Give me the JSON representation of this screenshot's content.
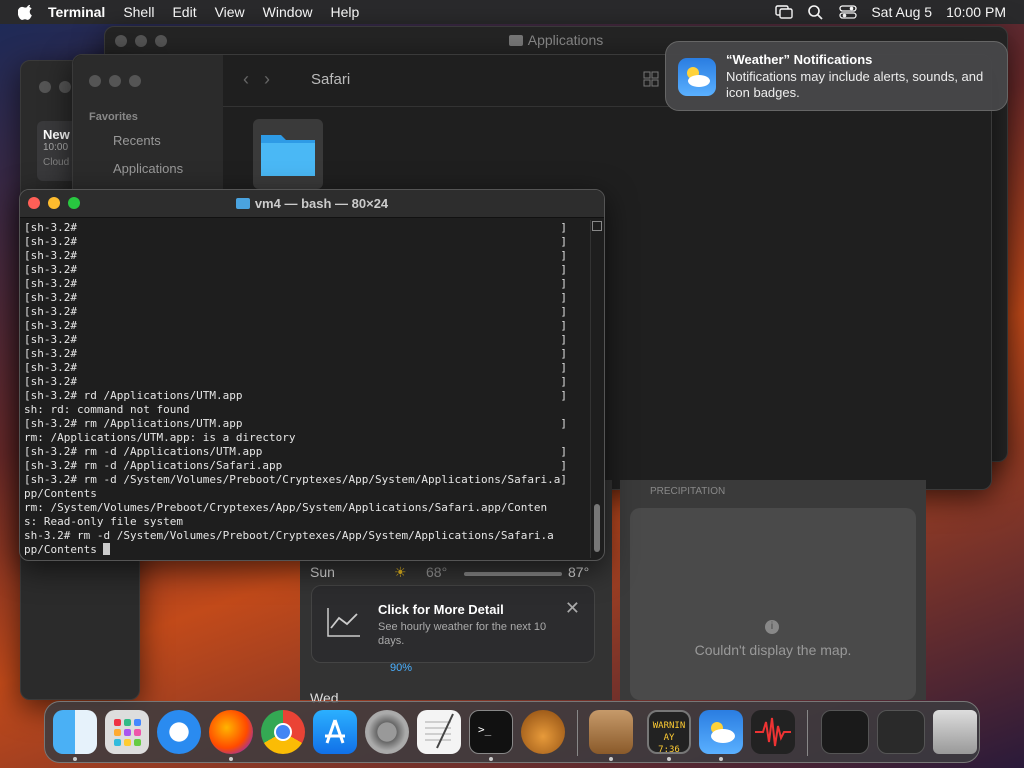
{
  "menubar": {
    "app": "Terminal",
    "items": [
      "Shell",
      "Edit",
      "View",
      "Window",
      "Help"
    ],
    "date": "Sat Aug 5",
    "time": "10:00 PM"
  },
  "finder_back": {
    "title": "Applications"
  },
  "finder": {
    "path": "Safari",
    "favorites_label": "Favorites",
    "sidebar_items": [
      "Recents",
      "Applications"
    ]
  },
  "notes": {
    "title": "New",
    "time": "10:00",
    "sub": "Cloud"
  },
  "terminal": {
    "title": "vm4 — bash — 80×24",
    "lines": [
      "[sh-3.2#                                                                         ]",
      "[sh-3.2#                                                                         ]",
      "[sh-3.2#                                                                         ]",
      "[sh-3.2#                                                                         ]",
      "[sh-3.2#                                                                         ]",
      "[sh-3.2#                                                                         ]",
      "[sh-3.2#                                                                         ]",
      "[sh-3.2#                                                                         ]",
      "[sh-3.2#                                                                         ]",
      "[sh-3.2#                                                                         ]",
      "[sh-3.2#                                                                         ]",
      "[sh-3.2#                                                                         ]",
      "[sh-3.2# rd /Applications/UTM.app                                                ]",
      "sh: rd: command not found",
      "[sh-3.2# rm /Applications/UTM.app                                                ]",
      "rm: /Applications/UTM.app: is a directory",
      "[sh-3.2# rm -d /Applications/UTM.app                                             ]",
      "[sh-3.2# rm -d /Applications/Safari.app                                          ]",
      "[sh-3.2# rm -d /System/Volumes/Preboot/Cryptexes/App/System/Applications/Safari.a]",
      "pp/Contents",
      "rm: /System/Volumes/Preboot/Cryptexes/App/System/Applications/Safari.app/Conten",
      "s: Read-only file system",
      "sh-3.2# rm -d /System/Volumes/Preboot/Cryptexes/App/System/Applications/Safari.a",
      "pp/Contents "
    ]
  },
  "notification": {
    "title": "“Weather” Notifications",
    "body": "Notifications may include alerts, sounds, and icon badges."
  },
  "weather": {
    "day": "Sun",
    "low": "68°",
    "high": "87°",
    "precip": "90%",
    "next_day": "Wed",
    "detail_title": "Click for More Detail",
    "detail_sub": "See hourly weather for the next 10 days.",
    "map_msg": "Couldn't display the map.",
    "map_header": "PRECIPITATION"
  },
  "dock": {
    "apps": [
      "Finder",
      "Launchpad",
      "Safari",
      "Firefox",
      "Chrome",
      "App Store",
      "System Settings",
      "TextEdit",
      "Terminal",
      "GarageBand",
      "Archive Utility",
      "Console",
      "Weather",
      "Voice Memos"
    ],
    "extras": [
      "Window Preview 1",
      "Window Preview 2",
      "Trash"
    ],
    "console_text": "WARNIN AY 7:36"
  }
}
